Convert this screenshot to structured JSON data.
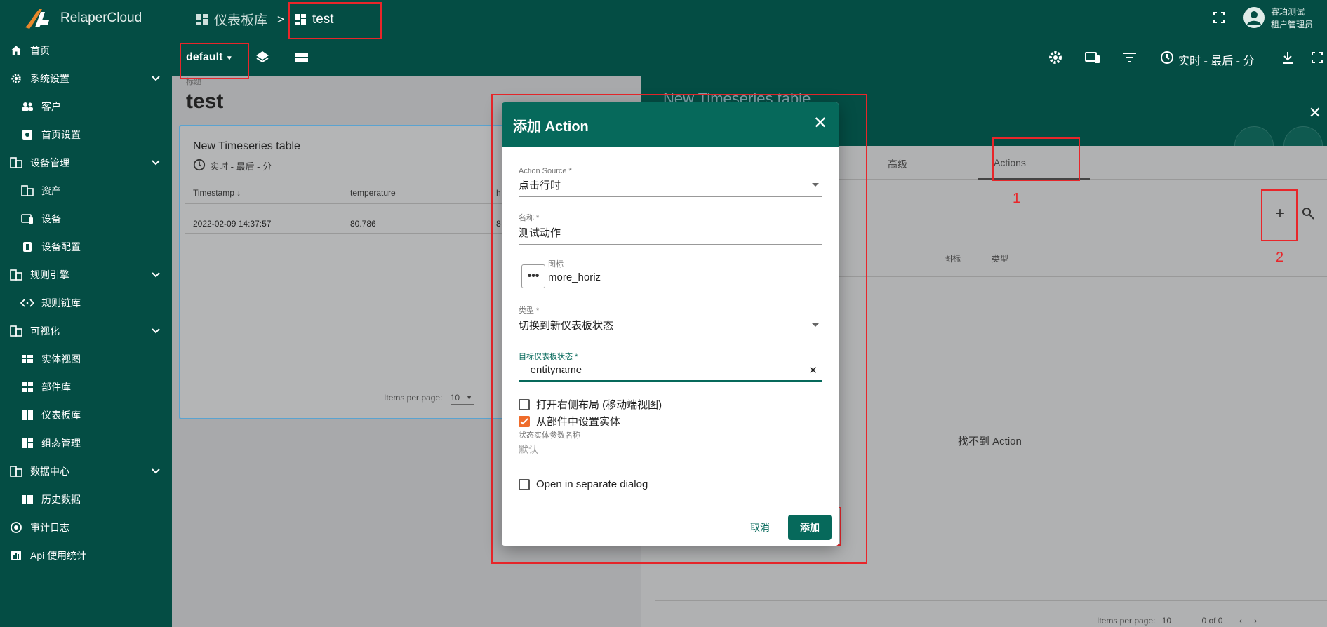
{
  "app": {
    "brand": "RelaperCloud"
  },
  "sidebar": {
    "items": [
      {
        "label": "首页",
        "icon": "home-icon"
      },
      {
        "label": "系统设置",
        "icon": "gear-icon",
        "expandable": true
      },
      {
        "label": "客户",
        "icon": "people-icon"
      },
      {
        "label": "首页设置",
        "icon": "settings-box-icon"
      },
      {
        "label": "设备管理",
        "icon": "building-icon",
        "expandable": true
      },
      {
        "label": "资产",
        "icon": "building-icon"
      },
      {
        "label": "设备",
        "icon": "devices-icon"
      },
      {
        "label": "设备配置",
        "icon": "profile-icon"
      },
      {
        "label": "规则引擎",
        "icon": "building-icon",
        "expandable": true
      },
      {
        "label": "规则链库",
        "icon": "code-icon"
      },
      {
        "label": "可视化",
        "icon": "building-icon",
        "expandable": true
      },
      {
        "label": "实体视图",
        "icon": "view-icon"
      },
      {
        "label": "部件库",
        "icon": "widgets-icon"
      },
      {
        "label": "仪表板库",
        "icon": "dashboard-icon"
      },
      {
        "label": "组态管理",
        "icon": "dashboard-icon"
      },
      {
        "label": "数据中心",
        "icon": "building-icon",
        "expandable": true
      },
      {
        "label": "历史数据",
        "icon": "view-icon"
      },
      {
        "label": "审计日志",
        "icon": "track-icon"
      },
      {
        "label": "Api 使用统计",
        "icon": "chart-icon"
      }
    ]
  },
  "topbar": {
    "crumb_parent": "仪表板库",
    "crumb_separator": ">",
    "crumb_current": "test",
    "user_name": "睿珀测试",
    "user_role": "租户管理员"
  },
  "toolbar": {
    "state": "default",
    "timewindow": "实时 - 最后 - 分"
  },
  "dashboard": {
    "title_label": "标题",
    "title": "test",
    "widget": {
      "title": "New Timeseries table",
      "time": "实时 - 最后 - 分",
      "columns": [
        "Timestamp",
        "temperature",
        "h"
      ],
      "row": [
        "2022-02-09 14:37:57",
        "80.786",
        "8"
      ],
      "pager_label": "Items per page:",
      "pager_value": "10"
    }
  },
  "right_panel": {
    "title": "New Timeseries table",
    "tabs": [
      "高级",
      "Actions"
    ],
    "columns": [
      "图标",
      "类型"
    ],
    "empty_text": "找不到 Action",
    "pager_label": "Items per page:",
    "pager_value": "10",
    "pager_range": "0 of 0"
  },
  "annotations": {
    "n1": "1",
    "n2": "2"
  },
  "dialog": {
    "title": "添加 Action",
    "action_source_label": "Action Source *",
    "action_source_value": "点击行时",
    "name_label": "名称 *",
    "name_value": "测试动作",
    "icon_label": "图标",
    "icon_value": "more_horiz",
    "type_label": "类型 *",
    "type_value": "切换到新仪表板状态",
    "target_state_label": "目标仪表板状态 *",
    "target_state_value": "__entityname_",
    "open_right_layout": "打开右侧布局 (移动端视图)",
    "set_entity_from_widget": "从部件中设置实体",
    "state_entity_param_label": "状态实体参数名称",
    "state_entity_param_placeholder": "默认",
    "open_separate_dialog": "Open in separate dialog",
    "cancel": "取消",
    "add": "添加"
  },
  "colors": {
    "primary": "#044d44",
    "accent": "#06695b",
    "checkbox": "#ef6c2b",
    "annotation": "#e8262a"
  }
}
